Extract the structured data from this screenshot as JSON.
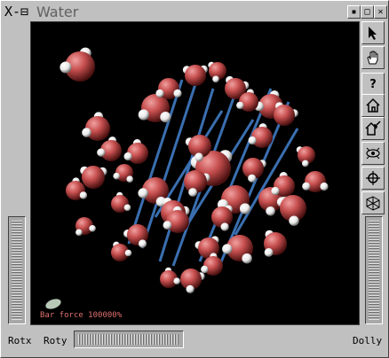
{
  "window": {
    "title": "Water",
    "logo": "X-⊟",
    "controls": [
      "▪",
      "□",
      "✕"
    ]
  },
  "viewer": {
    "overlay_text": "Bar force 100000%"
  },
  "tools": [
    {
      "name": "pick-arrow-icon"
    },
    {
      "name": "hand-icon"
    },
    {
      "name": "help-icon",
      "label": "?"
    },
    {
      "name": "home-icon"
    },
    {
      "name": "set-home-icon"
    },
    {
      "name": "view-all-icon"
    },
    {
      "name": "seek-icon"
    },
    {
      "name": "perspective-icon"
    }
  ],
  "bottom": {
    "rotx_label": "Rotx",
    "roty_label": "Roty",
    "dolly_label": "Dolly"
  },
  "colors": {
    "background": "#000000",
    "oxygen": "#c85050",
    "hydrogen": "#e8e8e8",
    "bond": "#3a6fb0"
  }
}
